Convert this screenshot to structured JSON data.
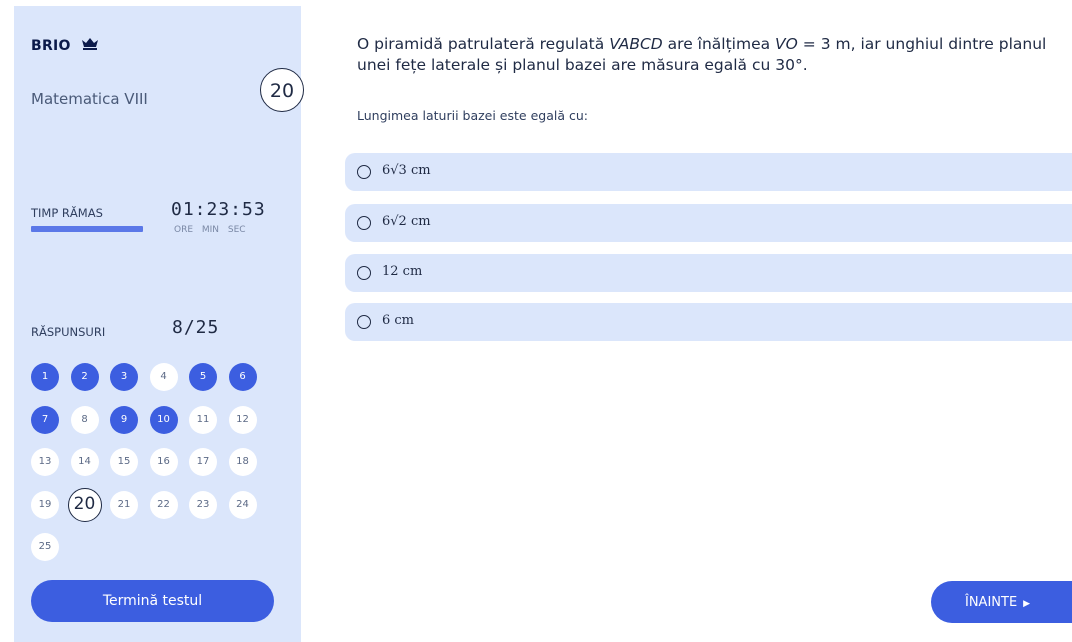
{
  "brand": {
    "name": "BRIO"
  },
  "sidebar": {
    "course": "Matematica VIII",
    "current_question": "20",
    "timer": {
      "label": "TIMP RĂMAS",
      "value": "01:23:53",
      "units": "ORE MIN SEC",
      "remaining_fraction": 0.39
    },
    "answers": {
      "label": "RĂSPUNSURI",
      "count": "8/25"
    },
    "questions": [
      {
        "n": "1",
        "state": "answered"
      },
      {
        "n": "2",
        "state": "answered"
      },
      {
        "n": "3",
        "state": "answered"
      },
      {
        "n": "4",
        "state": "unanswered"
      },
      {
        "n": "5",
        "state": "answered"
      },
      {
        "n": "6",
        "state": "answered"
      },
      {
        "n": "7",
        "state": "answered"
      },
      {
        "n": "8",
        "state": "unanswered"
      },
      {
        "n": "9",
        "state": "answered"
      },
      {
        "n": "10",
        "state": "answered"
      },
      {
        "n": "11",
        "state": "unanswered"
      },
      {
        "n": "12",
        "state": "unanswered"
      },
      {
        "n": "13",
        "state": "unanswered"
      },
      {
        "n": "14",
        "state": "unanswered"
      },
      {
        "n": "15",
        "state": "unanswered"
      },
      {
        "n": "16",
        "state": "unanswered"
      },
      {
        "n": "17",
        "state": "unanswered"
      },
      {
        "n": "18",
        "state": "unanswered"
      },
      {
        "n": "19",
        "state": "unanswered"
      },
      {
        "n": "20",
        "state": "current"
      },
      {
        "n": "21",
        "state": "unanswered"
      },
      {
        "n": "22",
        "state": "unanswered"
      },
      {
        "n": "23",
        "state": "unanswered"
      },
      {
        "n": "24",
        "state": "unanswered"
      },
      {
        "n": "25",
        "state": "unanswered"
      }
    ],
    "finish_label": "Termină testul"
  },
  "question": {
    "part1": "O piramidă patrulateră regulată ",
    "solid": "VABCD",
    "part2": " are înălțimea ",
    "height_name": "VO",
    "part3": " = 3 m, iar unghiul dintre planul unei fețe laterale și planul bazei are măsura egală cu 30°.",
    "prompt": "Lungimea laturii bazei este egală cu:"
  },
  "options": [
    {
      "label": "6√3 cm"
    },
    {
      "label": "6√2 cm"
    },
    {
      "label": "12 cm"
    },
    {
      "label": "6 cm"
    }
  ],
  "next_label": "ÎNAINTE",
  "colors": {
    "accent": "#3c5ee0",
    "panel": "#dbe6fb",
    "text": "#1f2a44"
  }
}
